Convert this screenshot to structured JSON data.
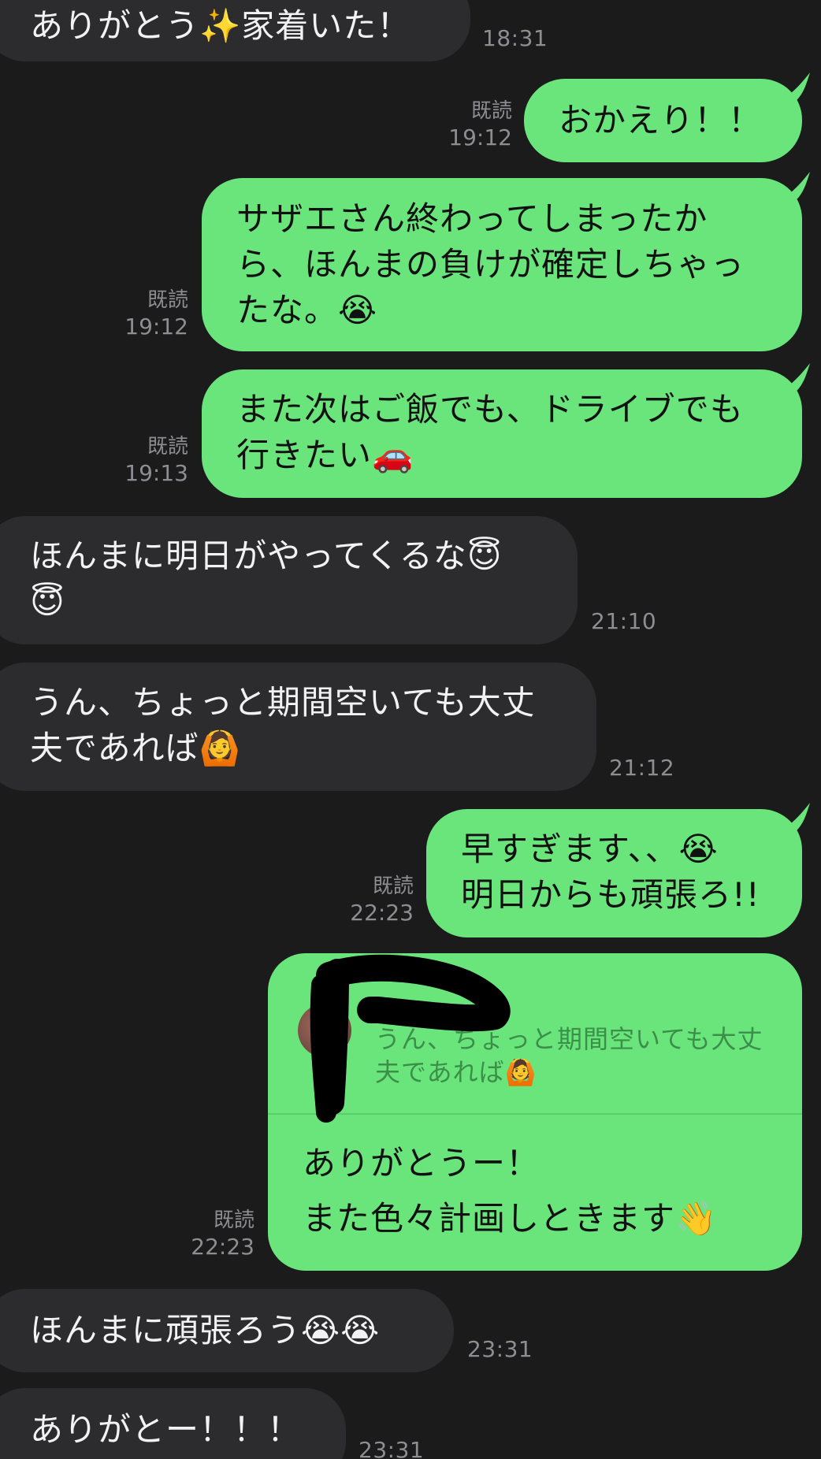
{
  "messages": [
    {
      "side": "in",
      "lines": [
        "ありがとう✨家着いた！"
      ],
      "time": "18:31"
    },
    {
      "side": "out",
      "lines": [
        "おかえり！！"
      ],
      "read": "既読",
      "time": "19:12"
    },
    {
      "side": "out",
      "lines": [
        "サザエさん終わってしまったか",
        "ら、ほんまの負けが確定しちゃっ",
        "たな。😭"
      ],
      "read": "既読",
      "time": "19:12"
    },
    {
      "side": "out",
      "lines": [
        "また次はご飯でも、ドライブでも",
        "行きたい🚗"
      ],
      "read": "既読",
      "time": "19:13"
    },
    {
      "side": "in",
      "lines": [
        "ほんまに明日がやってくるな😇",
        "😇"
      ],
      "time": "21:10"
    },
    {
      "side": "in",
      "lines": [
        "うん、ちょっと期間空いても大丈",
        "夫であれば🙆"
      ],
      "time": "21:12"
    },
    {
      "side": "out",
      "lines": [
        "早すぎます、、😭",
        "明日からも頑張ろ!!"
      ],
      "read": "既読",
      "time": "22:23"
    },
    {
      "side": "out",
      "reply_quote": {
        "lines": [
          "うん、ちょっと期間空いても大丈",
          "夫であれば🙆"
        ]
      },
      "lines": [
        "ありがとうー！",
        "また色々計画しときます👋"
      ],
      "read": "既読",
      "time": "22:23"
    },
    {
      "side": "in",
      "lines": [
        "ほんまに頑張ろう😭😭"
      ],
      "time": "23:31"
    },
    {
      "side": "in",
      "lines": [
        "ありがとー！！！"
      ],
      "time": "23:31"
    }
  ],
  "colors": {
    "background": "#1b1b1c",
    "incoming_bubble": "#2c2c2e",
    "outgoing_bubble": "#6ae57c",
    "meta_text": "#8d8d92"
  }
}
